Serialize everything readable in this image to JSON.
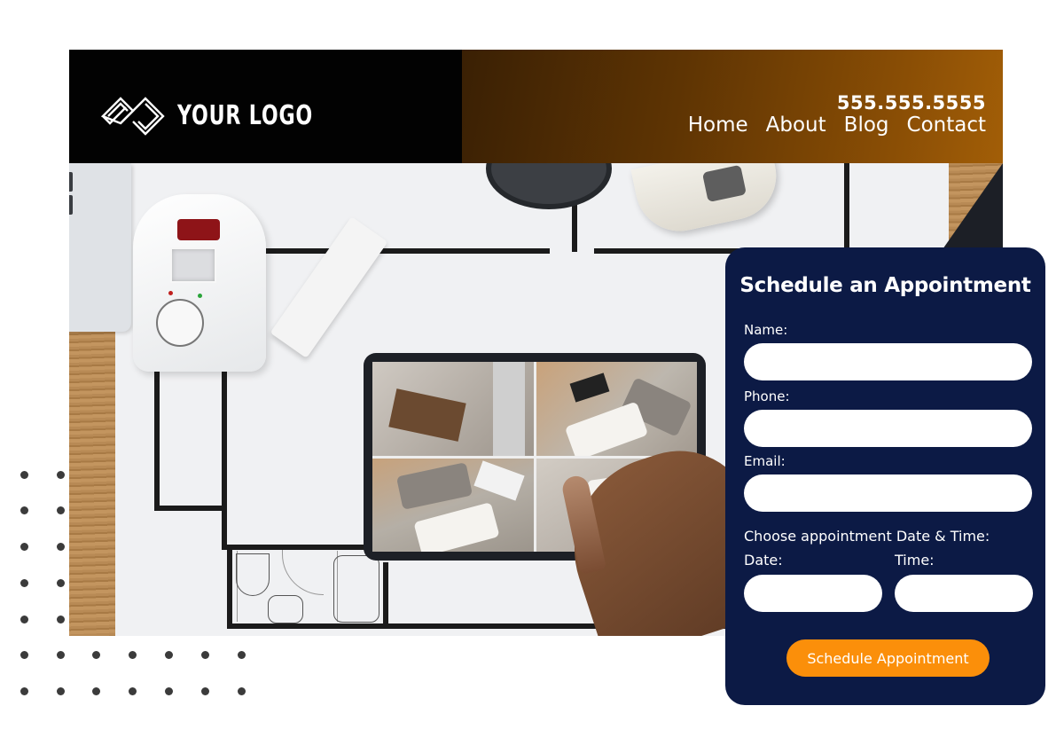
{
  "header": {
    "logo_text": "YOUR LOGO",
    "phone": "555.555.5555",
    "nav": [
      {
        "label": "Home"
      },
      {
        "label": "About"
      },
      {
        "label": "Blog"
      },
      {
        "label": "Contact"
      }
    ]
  },
  "hero": {
    "image_description": "Security devices (motion sensor alarm, door contact sensor, CCTV camera) on a floor plan with a tablet showing four camera feeds"
  },
  "form": {
    "title": "Schedule an Appointment",
    "fields": {
      "name": {
        "label": "Name:",
        "value": "",
        "placeholder": ""
      },
      "phone": {
        "label": "Phone:",
        "value": "",
        "placeholder": ""
      },
      "email": {
        "label": "Email:",
        "value": "",
        "placeholder": ""
      },
      "datetime_prompt": "Choose appointment Date & Time:",
      "date": {
        "label": "Date:",
        "value": "",
        "placeholder": ""
      },
      "time": {
        "label": "Time:",
        "value": "",
        "placeholder": ""
      }
    },
    "submit_label": "Schedule Appointment"
  },
  "colors": {
    "card_bg": "#0c1a45",
    "accent": "#fb8f0a",
    "header_gradient_start": "#3a2004",
    "header_gradient_end": "#a25e07",
    "dots": "#3b3b3b"
  }
}
